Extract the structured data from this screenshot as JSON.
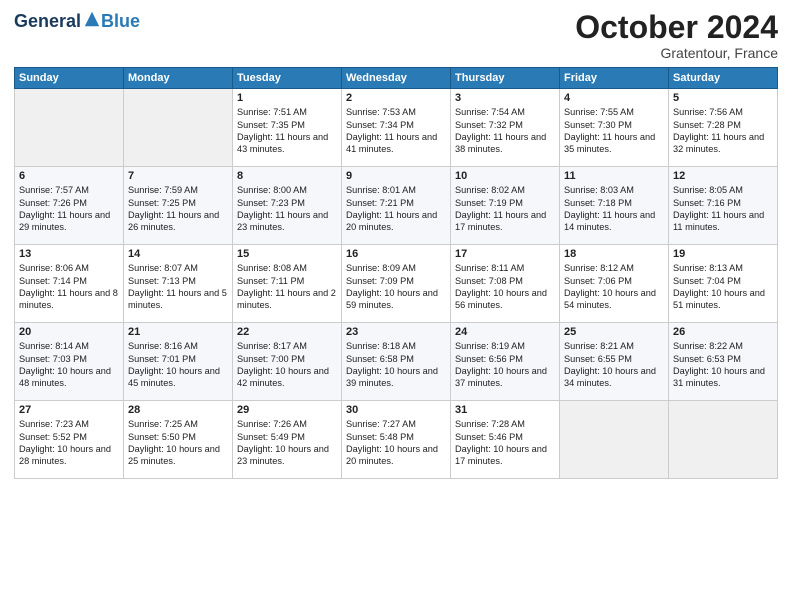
{
  "header": {
    "logo_general": "General",
    "logo_blue": "Blue",
    "month_title": "October 2024",
    "location": "Gratentour, France"
  },
  "weekdays": [
    "Sunday",
    "Monday",
    "Tuesday",
    "Wednesday",
    "Thursday",
    "Friday",
    "Saturday"
  ],
  "weeks": [
    [
      {
        "day": "",
        "sunrise": "",
        "sunset": "",
        "daylight": ""
      },
      {
        "day": "",
        "sunrise": "",
        "sunset": "",
        "daylight": ""
      },
      {
        "day": "1",
        "sunrise": "Sunrise: 7:51 AM",
        "sunset": "Sunset: 7:35 PM",
        "daylight": "Daylight: 11 hours and 43 minutes."
      },
      {
        "day": "2",
        "sunrise": "Sunrise: 7:53 AM",
        "sunset": "Sunset: 7:34 PM",
        "daylight": "Daylight: 11 hours and 41 minutes."
      },
      {
        "day": "3",
        "sunrise": "Sunrise: 7:54 AM",
        "sunset": "Sunset: 7:32 PM",
        "daylight": "Daylight: 11 hours and 38 minutes."
      },
      {
        "day": "4",
        "sunrise": "Sunrise: 7:55 AM",
        "sunset": "Sunset: 7:30 PM",
        "daylight": "Daylight: 11 hours and 35 minutes."
      },
      {
        "day": "5",
        "sunrise": "Sunrise: 7:56 AM",
        "sunset": "Sunset: 7:28 PM",
        "daylight": "Daylight: 11 hours and 32 minutes."
      }
    ],
    [
      {
        "day": "6",
        "sunrise": "Sunrise: 7:57 AM",
        "sunset": "Sunset: 7:26 PM",
        "daylight": "Daylight: 11 hours and 29 minutes."
      },
      {
        "day": "7",
        "sunrise": "Sunrise: 7:59 AM",
        "sunset": "Sunset: 7:25 PM",
        "daylight": "Daylight: 11 hours and 26 minutes."
      },
      {
        "day": "8",
        "sunrise": "Sunrise: 8:00 AM",
        "sunset": "Sunset: 7:23 PM",
        "daylight": "Daylight: 11 hours and 23 minutes."
      },
      {
        "day": "9",
        "sunrise": "Sunrise: 8:01 AM",
        "sunset": "Sunset: 7:21 PM",
        "daylight": "Daylight: 11 hours and 20 minutes."
      },
      {
        "day": "10",
        "sunrise": "Sunrise: 8:02 AM",
        "sunset": "Sunset: 7:19 PM",
        "daylight": "Daylight: 11 hours and 17 minutes."
      },
      {
        "day": "11",
        "sunrise": "Sunrise: 8:03 AM",
        "sunset": "Sunset: 7:18 PM",
        "daylight": "Daylight: 11 hours and 14 minutes."
      },
      {
        "day": "12",
        "sunrise": "Sunrise: 8:05 AM",
        "sunset": "Sunset: 7:16 PM",
        "daylight": "Daylight: 11 hours and 11 minutes."
      }
    ],
    [
      {
        "day": "13",
        "sunrise": "Sunrise: 8:06 AM",
        "sunset": "Sunset: 7:14 PM",
        "daylight": "Daylight: 11 hours and 8 minutes."
      },
      {
        "day": "14",
        "sunrise": "Sunrise: 8:07 AM",
        "sunset": "Sunset: 7:13 PM",
        "daylight": "Daylight: 11 hours and 5 minutes."
      },
      {
        "day": "15",
        "sunrise": "Sunrise: 8:08 AM",
        "sunset": "Sunset: 7:11 PM",
        "daylight": "Daylight: 11 hours and 2 minutes."
      },
      {
        "day": "16",
        "sunrise": "Sunrise: 8:09 AM",
        "sunset": "Sunset: 7:09 PM",
        "daylight": "Daylight: 10 hours and 59 minutes."
      },
      {
        "day": "17",
        "sunrise": "Sunrise: 8:11 AM",
        "sunset": "Sunset: 7:08 PM",
        "daylight": "Daylight: 10 hours and 56 minutes."
      },
      {
        "day": "18",
        "sunrise": "Sunrise: 8:12 AM",
        "sunset": "Sunset: 7:06 PM",
        "daylight": "Daylight: 10 hours and 54 minutes."
      },
      {
        "day": "19",
        "sunrise": "Sunrise: 8:13 AM",
        "sunset": "Sunset: 7:04 PM",
        "daylight": "Daylight: 10 hours and 51 minutes."
      }
    ],
    [
      {
        "day": "20",
        "sunrise": "Sunrise: 8:14 AM",
        "sunset": "Sunset: 7:03 PM",
        "daylight": "Daylight: 10 hours and 48 minutes."
      },
      {
        "day": "21",
        "sunrise": "Sunrise: 8:16 AM",
        "sunset": "Sunset: 7:01 PM",
        "daylight": "Daylight: 10 hours and 45 minutes."
      },
      {
        "day": "22",
        "sunrise": "Sunrise: 8:17 AM",
        "sunset": "Sunset: 7:00 PM",
        "daylight": "Daylight: 10 hours and 42 minutes."
      },
      {
        "day": "23",
        "sunrise": "Sunrise: 8:18 AM",
        "sunset": "Sunset: 6:58 PM",
        "daylight": "Daylight: 10 hours and 39 minutes."
      },
      {
        "day": "24",
        "sunrise": "Sunrise: 8:19 AM",
        "sunset": "Sunset: 6:56 PM",
        "daylight": "Daylight: 10 hours and 37 minutes."
      },
      {
        "day": "25",
        "sunrise": "Sunrise: 8:21 AM",
        "sunset": "Sunset: 6:55 PM",
        "daylight": "Daylight: 10 hours and 34 minutes."
      },
      {
        "day": "26",
        "sunrise": "Sunrise: 8:22 AM",
        "sunset": "Sunset: 6:53 PM",
        "daylight": "Daylight: 10 hours and 31 minutes."
      }
    ],
    [
      {
        "day": "27",
        "sunrise": "Sunrise: 7:23 AM",
        "sunset": "Sunset: 5:52 PM",
        "daylight": "Daylight: 10 hours and 28 minutes."
      },
      {
        "day": "28",
        "sunrise": "Sunrise: 7:25 AM",
        "sunset": "Sunset: 5:50 PM",
        "daylight": "Daylight: 10 hours and 25 minutes."
      },
      {
        "day": "29",
        "sunrise": "Sunrise: 7:26 AM",
        "sunset": "Sunset: 5:49 PM",
        "daylight": "Daylight: 10 hours and 23 minutes."
      },
      {
        "day": "30",
        "sunrise": "Sunrise: 7:27 AM",
        "sunset": "Sunset: 5:48 PM",
        "daylight": "Daylight: 10 hours and 20 minutes."
      },
      {
        "day": "31",
        "sunrise": "Sunrise: 7:28 AM",
        "sunset": "Sunset: 5:46 PM",
        "daylight": "Daylight: 10 hours and 17 minutes."
      },
      {
        "day": "",
        "sunrise": "",
        "sunset": "",
        "daylight": ""
      },
      {
        "day": "",
        "sunrise": "",
        "sunset": "",
        "daylight": ""
      }
    ]
  ]
}
